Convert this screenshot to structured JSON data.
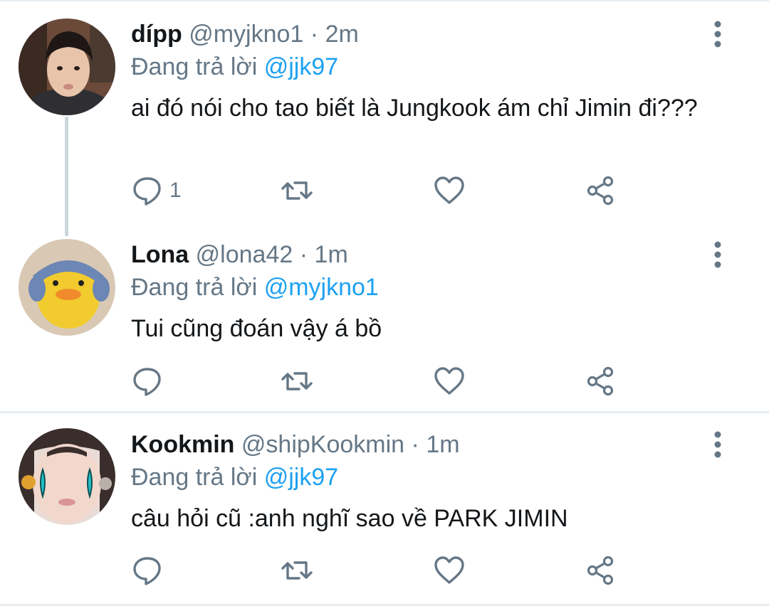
{
  "tweets": [
    {
      "name": "dípp",
      "handle": "@myjkno1",
      "separator": "·",
      "time": "2m",
      "reply_prefix": "Đang trả lời",
      "reply_to": "@jjk97",
      "text": "ai đó nói cho tao biết là Jungkook ám chỉ Jimin đi???",
      "reply_count": "1",
      "avatar_icon": "person-photo"
    },
    {
      "name": "Lona",
      "handle": "@lona42",
      "separator": "·",
      "time": "1m",
      "reply_prefix": "Đang trả lời",
      "reply_to": "@myjkno1",
      "text": "Tui cũng đoán vậy á bồ",
      "reply_count": "",
      "avatar_icon": "duck-photo"
    },
    {
      "name": "Kookmin",
      "handle": "@shipKookmin",
      "separator": "·",
      "time": "1m",
      "reply_prefix": "Đang trả lời",
      "reply_to": "@jjk97",
      "text": "câu hỏi cũ :anh nghĩ sao về PARK JIMIN",
      "reply_count": "",
      "avatar_icon": "crying-face-photo"
    }
  ],
  "icons": {
    "reply": "reply-icon",
    "retweet": "retweet-icon",
    "like": "heart-icon",
    "share": "share-icon",
    "more": "more-vertical-icon"
  },
  "colors": {
    "text": "#14171a",
    "secondary": "#657786",
    "mention": "#1da1f2",
    "divider": "#e6ecf0",
    "thread_line": "#ccd6dd"
  }
}
